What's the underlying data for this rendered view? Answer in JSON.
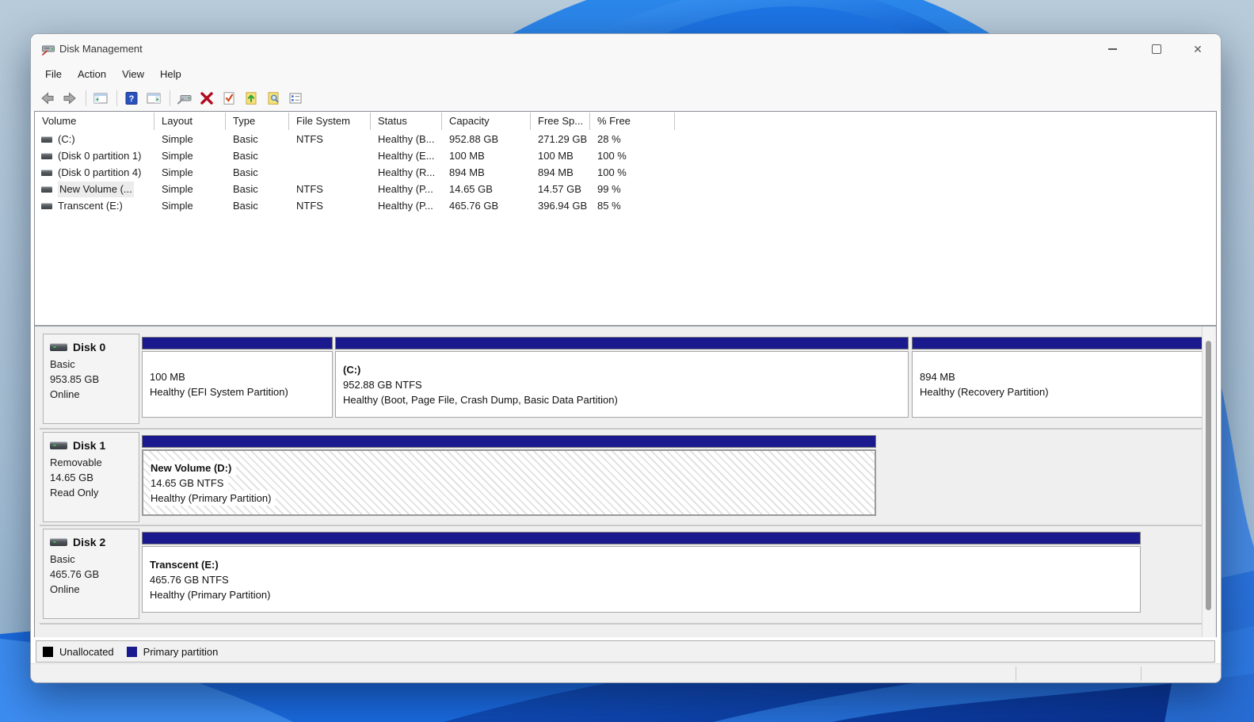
{
  "titlebar": {
    "title": "Disk Management"
  },
  "menubar": {
    "items": [
      "File",
      "Action",
      "View",
      "Help"
    ]
  },
  "toolbar": {
    "buttons": [
      "back",
      "forward",
      "show-console-tree",
      "help",
      "show-action-pane",
      "rescan-disks",
      "delete-volume",
      "mark-partition-active",
      "open",
      "explore",
      "properties"
    ]
  },
  "volume_list": {
    "columns": [
      "Volume",
      "Layout",
      "Type",
      "File System",
      "Status",
      "Capacity",
      "Free Sp...",
      "% Free"
    ],
    "rows": [
      {
        "volume": "(C:)",
        "layout": "Simple",
        "type": "Basic",
        "file_system": "NTFS",
        "status": "Healthy (B...",
        "capacity": "952.88 GB",
        "free_space": "271.29 GB",
        "pct_free": "28 %"
      },
      {
        "volume": "(Disk 0 partition 1)",
        "layout": "Simple",
        "type": "Basic",
        "file_system": "",
        "status": "Healthy (E...",
        "capacity": "100 MB",
        "free_space": "100 MB",
        "pct_free": "100 %"
      },
      {
        "volume": "(Disk 0 partition 4)",
        "layout": "Simple",
        "type": "Basic",
        "file_system": "",
        "status": "Healthy (R...",
        "capacity": "894 MB",
        "free_space": "894 MB",
        "pct_free": "100 %"
      },
      {
        "volume": "New Volume (...",
        "layout": "Simple",
        "type": "Basic",
        "file_system": "NTFS",
        "status": "Healthy (P...",
        "capacity": "14.65 GB",
        "free_space": "14.57 GB",
        "pct_free": "99 %"
      },
      {
        "volume": "Transcent (E:)",
        "layout": "Simple",
        "type": "Basic",
        "file_system": "NTFS",
        "status": "Healthy (P...",
        "capacity": "465.76 GB",
        "free_space": "396.94 GB",
        "pct_free": "85 %"
      }
    ]
  },
  "disks": [
    {
      "name": "Disk 0",
      "kind": "Basic",
      "size": "953.85 GB",
      "state": "Online",
      "partitions": [
        {
          "name": "",
          "size_line": "100 MB",
          "status_line": "Healthy (EFI System Partition)"
        },
        {
          "name": "(C:)",
          "size_line": "952.88 GB NTFS",
          "status_line": "Healthy (Boot, Page File, Crash Dump, Basic Data Partition)"
        },
        {
          "name": "",
          "size_line": "894 MB",
          "status_line": "Healthy (Recovery Partition)"
        }
      ]
    },
    {
      "name": "Disk 1",
      "kind": "Removable",
      "size": "14.65 GB",
      "state": "Read Only",
      "partitions": [
        {
          "name": "New Volume  (D:)",
          "size_line": "14.65 GB NTFS",
          "status_line": "Healthy (Primary Partition)"
        }
      ]
    },
    {
      "name": "Disk 2",
      "kind": "Basic",
      "size": "465.76 GB",
      "state": "Online",
      "partitions": [
        {
          "name": "Transcent  (E:)",
          "size_line": "465.76 GB NTFS",
          "status_line": "Healthy (Primary Partition)"
        }
      ]
    }
  ],
  "legend": {
    "unallocated_label": "Unallocated",
    "primary_label": "Primary partition"
  },
  "colors": {
    "primary_partition": "#1a1a8e",
    "unallocated": "#000000",
    "partition_bar": "#1a1a8e"
  }
}
